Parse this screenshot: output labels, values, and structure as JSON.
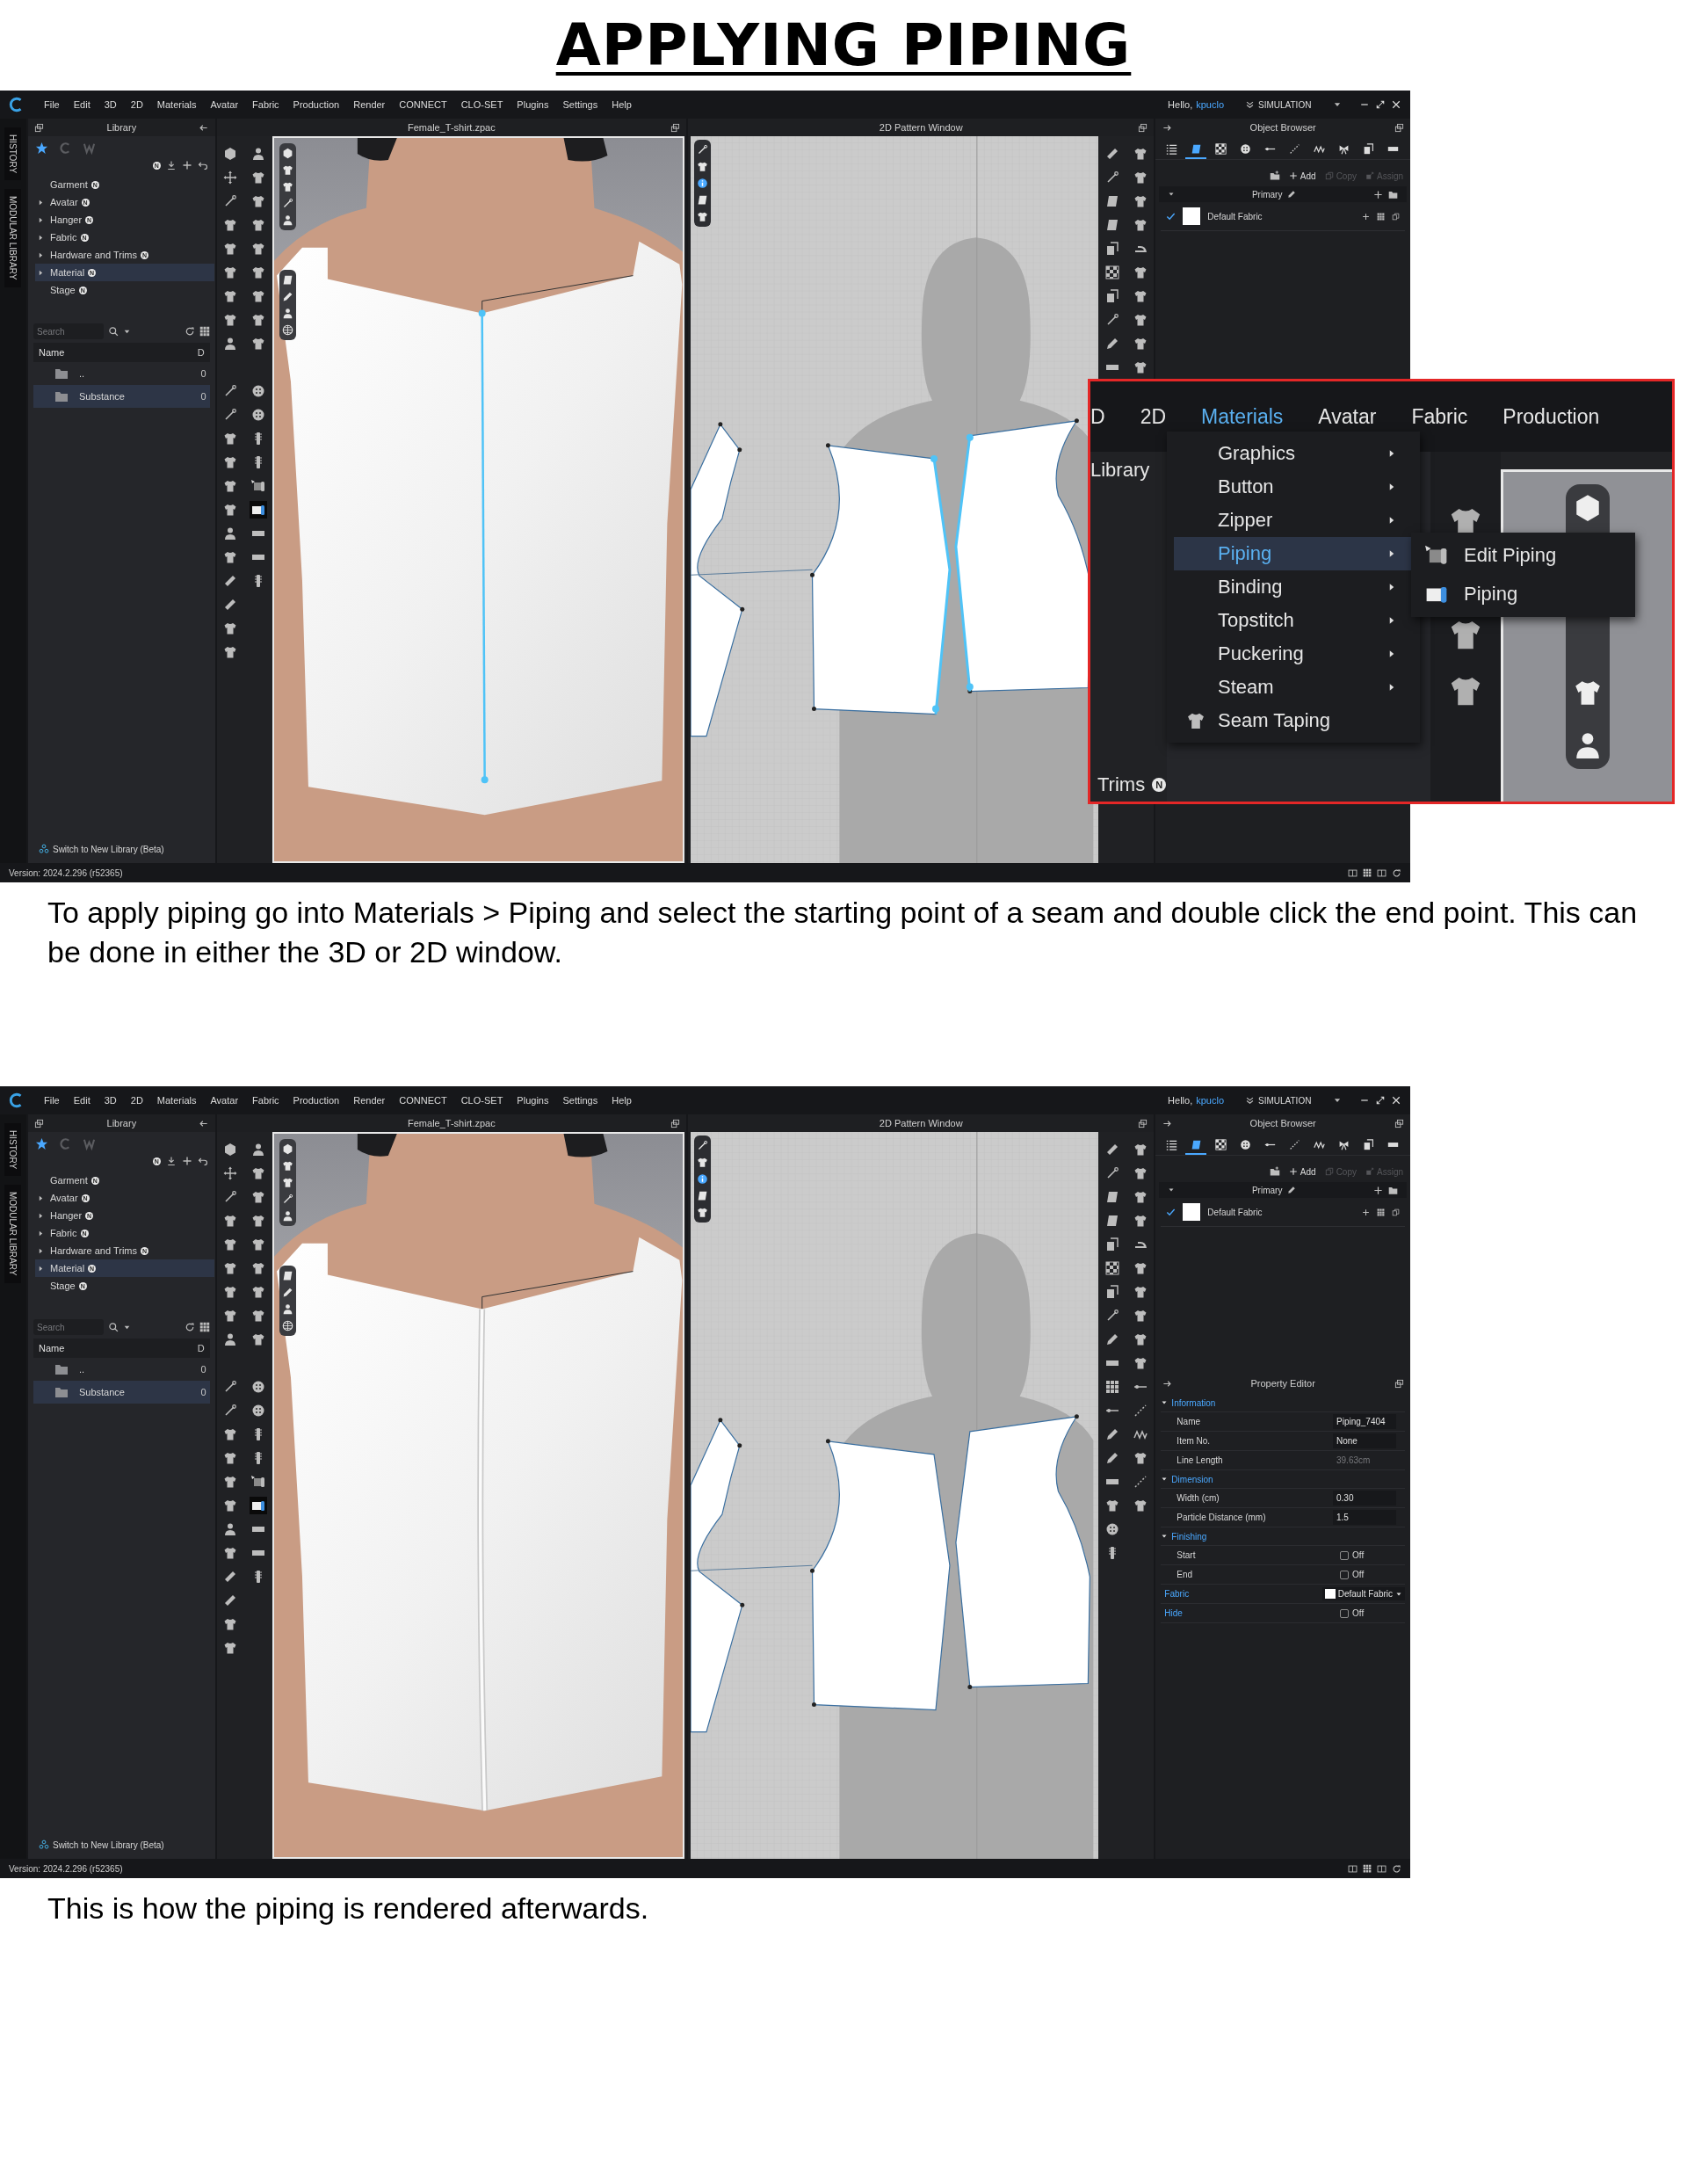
{
  "title": "APPLYING PIPING",
  "sections": [
    {
      "app": {
        "menu_bar": {
          "menus": [
            "File",
            "Edit",
            "3D",
            "2D",
            "Materials",
            "Avatar",
            "Fabric",
            "Production",
            "Render",
            "CONNECT",
            "CLO-SET",
            "Plugins",
            "Settings",
            "Help"
          ],
          "greeting": "Hello,",
          "user": "kpuclo",
          "mode": "SIMULATION"
        },
        "side_tabs": [
          "HISTORY",
          "MODULAR LIBRARY"
        ],
        "library": {
          "title": "Library",
          "tabs": [
            {
              "kind": "star",
              "selected": true
            },
            {
              "kind": "c",
              "selected": false
            },
            {
              "kind": "w",
              "selected": false
            }
          ],
          "badge": "N",
          "tree": [
            {
              "label": "Garment",
              "badge": "N",
              "expandable": false,
              "selected": false
            },
            {
              "label": "Avatar",
              "badge": "N",
              "expandable": true,
              "selected": false
            },
            {
              "label": "Hanger",
              "badge": "N",
              "expandable": true,
              "selected": false
            },
            {
              "label": "Fabric",
              "badge": "N",
              "expandable": true,
              "selected": false
            },
            {
              "label": "Hardware and Trims",
              "badge": "N",
              "expandable": true,
              "selected": false
            },
            {
              "label": "Material",
              "badge": "N",
              "expandable": true,
              "selected": true
            },
            {
              "label": "Stage",
              "badge": "N",
              "expandable": false,
              "selected": false
            }
          ],
          "search": {
            "placeholder": "Search"
          },
          "columns": [
            "Name",
            "D"
          ],
          "rows": [
            {
              "name": "..",
              "column_2": "0",
              "selected": false
            },
            {
              "name": "Substance",
              "column_2": "0",
              "selected": true
            }
          ],
          "footer_link": "Switch to New Library (Beta)"
        },
        "viewport_3d": {
          "title": "Female_T-shirt.zpac",
          "kind": "selected"
        },
        "pattern_window": {
          "title": "2D Pattern Window",
          "kind": "selected"
        },
        "object_browser": {
          "title": "Object Browser",
          "tabs": [
            {
              "kind": "list",
              "selected": false
            },
            {
              "kind": "fabric",
              "selected": true
            },
            {
              "kind": "checker",
              "selected": false
            },
            {
              "kind": "button",
              "selected": false
            },
            {
              "kind": "line",
              "selected": false
            },
            {
              "kind": "dashed",
              "selected": false
            },
            {
              "kind": "zigzag",
              "selected": false
            },
            {
              "kind": "bow",
              "selected": false
            },
            {
              "kind": "swatch",
              "selected": false
            },
            {
              "kind": "bar",
              "selected": false
            }
          ],
          "actions": [
            {
              "kind": "add",
              "label": "Add",
              "disabled": false
            },
            {
              "kind": "copy",
              "label": "Copy",
              "disabled": true
            },
            {
              "kind": "assign",
              "label": "Assign",
              "disabled": true
            }
          ],
          "group": "Primary",
          "fabrics": [
            {
              "name": "Default Fabric",
              "checked": true
            }
          ]
        },
        "version": "Version: 2024.2.296 (r52365)"
      },
      "callout": {
        "menus": [
          {
            "label": "D",
            "selected": false
          },
          {
            "label": "2D",
            "selected": false
          },
          {
            "label": "Materials",
            "selected": true
          },
          {
            "label": "Avatar",
            "selected": false
          },
          {
            "label": "Fabric",
            "selected": false
          },
          {
            "label": "Production",
            "selected": false
          }
        ],
        "panel_label": "Library",
        "menu_items": [
          {
            "label": "Graphics",
            "submenu": true,
            "selected": false
          },
          {
            "label": "Button",
            "submenu": true,
            "selected": false
          },
          {
            "label": "Zipper",
            "submenu": true,
            "selected": false
          },
          {
            "label": "Piping",
            "submenu": true,
            "selected": true
          },
          {
            "label": "Binding",
            "submenu": true,
            "selected": false
          },
          {
            "label": "Topstitch",
            "submenu": true,
            "selected": false
          },
          {
            "label": "Puckering",
            "submenu": true,
            "selected": false
          },
          {
            "label": "Steam",
            "submenu": true,
            "selected": false
          },
          {
            "label": "Seam Taping",
            "submenu": false,
            "selected": false
          }
        ],
        "submenu_items": [
          {
            "kind": "edit",
            "label": "Edit Piping"
          },
          {
            "kind": "create",
            "label": "Piping"
          }
        ],
        "trims_label": "Trims",
        "trims_badge": "N"
      },
      "caption": "To apply piping go into Materials > Piping and select the starting point of a seam and double click the end point. This can be done in either the 3D or 2D window."
    },
    {
      "app": {
        "menu_bar": {
          "menus": [
            "File",
            "Edit",
            "3D",
            "2D",
            "Materials",
            "Avatar",
            "Fabric",
            "Production",
            "Render",
            "CONNECT",
            "CLO-SET",
            "Plugins",
            "Settings",
            "Help"
          ],
          "greeting": "Hello,",
          "user": "kpuclo",
          "mode": "SIMULATION"
        },
        "side_tabs": [
          "HISTORY",
          "MODULAR LIBRARY"
        ],
        "library": {
          "title": "Library",
          "tabs": [
            {
              "kind": "star",
              "selected": true
            },
            {
              "kind": "c",
              "selected": false
            },
            {
              "kind": "w",
              "selected": false
            }
          ],
          "badge": "N",
          "tree": [
            {
              "label": "Garment",
              "badge": "N",
              "expandable": false,
              "selected": false
            },
            {
              "label": "Avatar",
              "badge": "N",
              "expandable": true,
              "selected": false
            },
            {
              "label": "Hanger",
              "badge": "N",
              "expandable": true,
              "selected": false
            },
            {
              "label": "Fabric",
              "badge": "N",
              "expandable": true,
              "selected": false
            },
            {
              "label": "Hardware and Trims",
              "badge": "N",
              "expandable": true,
              "selected": false
            },
            {
              "label": "Material",
              "badge": "N",
              "expandable": true,
              "selected": true
            },
            {
              "label": "Stage",
              "badge": "N",
              "expandable": false,
              "selected": false
            }
          ],
          "search": {
            "placeholder": "Search"
          },
          "columns": [
            "Name",
            "D"
          ],
          "rows": [
            {
              "name": "..",
              "column_2": "0",
              "selected": false
            },
            {
              "name": "Substance",
              "column_2": "0",
              "selected": true
            }
          ],
          "footer_link": "Switch to New Library (Beta)"
        },
        "viewport_3d": {
          "title": "Female_T-shirt.zpac",
          "kind": "piped"
        },
        "pattern_window": {
          "title": "2D Pattern Window",
          "kind": "plain"
        },
        "object_browser": {
          "title": "Object Browser",
          "tabs": [
            {
              "kind": "list",
              "selected": false
            },
            {
              "kind": "fabric",
              "selected": true
            },
            {
              "kind": "checker",
              "selected": false
            },
            {
              "kind": "button",
              "selected": false
            },
            {
              "kind": "line",
              "selected": false
            },
            {
              "kind": "dashed",
              "selected": false
            },
            {
              "kind": "zigzag",
              "selected": false
            },
            {
              "kind": "bow",
              "selected": false
            },
            {
              "kind": "swatch",
              "selected": false
            },
            {
              "kind": "bar",
              "selected": false
            }
          ],
          "actions": [
            {
              "kind": "add",
              "label": "Add",
              "disabled": false
            },
            {
              "kind": "copy",
              "label": "Copy",
              "disabled": true
            },
            {
              "kind": "assign",
              "label": "Assign",
              "disabled": true
            }
          ],
          "group": "Primary",
          "fabrics": [
            {
              "name": "Default Fabric",
              "checked": true
            }
          ]
        },
        "property_editor": {
          "title": "Property Editor",
          "groups": [
            {
              "label": "Information",
              "expanded": true,
              "rows": [
                {
                  "label": "Name",
                  "kind": "field",
                  "value": "Piping_7404"
                },
                {
                  "label": "Item No.",
                  "kind": "field",
                  "value": "None"
                },
                {
                  "label": "Line Length",
                  "kind": "readonly",
                  "value": "39.63cm"
                }
              ]
            },
            {
              "label": "Dimension",
              "expanded": true,
              "rows": [
                {
                  "label": "Width (cm)",
                  "kind": "field",
                  "value": "0.30"
                },
                {
                  "label": "Particle Distance (mm)",
                  "kind": "field",
                  "value": "1.5"
                }
              ]
            },
            {
              "label": "Finishing",
              "expanded": true,
              "rows": [
                {
                  "label": "Start",
                  "kind": "toggle",
                  "checked": false,
                  "value": "Off"
                },
                {
                  "label": "End",
                  "kind": "toggle",
                  "checked": false,
                  "value": "Off"
                }
              ]
            }
          ],
          "rows": [
            {
              "label": "Fabric",
              "kind": "dropdown",
              "value": "Default Fabric"
            },
            {
              "label": "Hide",
              "kind": "toggle",
              "checked": false,
              "value": "Off"
            }
          ]
        },
        "version": "Version: 2024.2.296 (r52365)"
      },
      "caption": "This is how the piping is rendered afterwards."
    }
  ]
}
